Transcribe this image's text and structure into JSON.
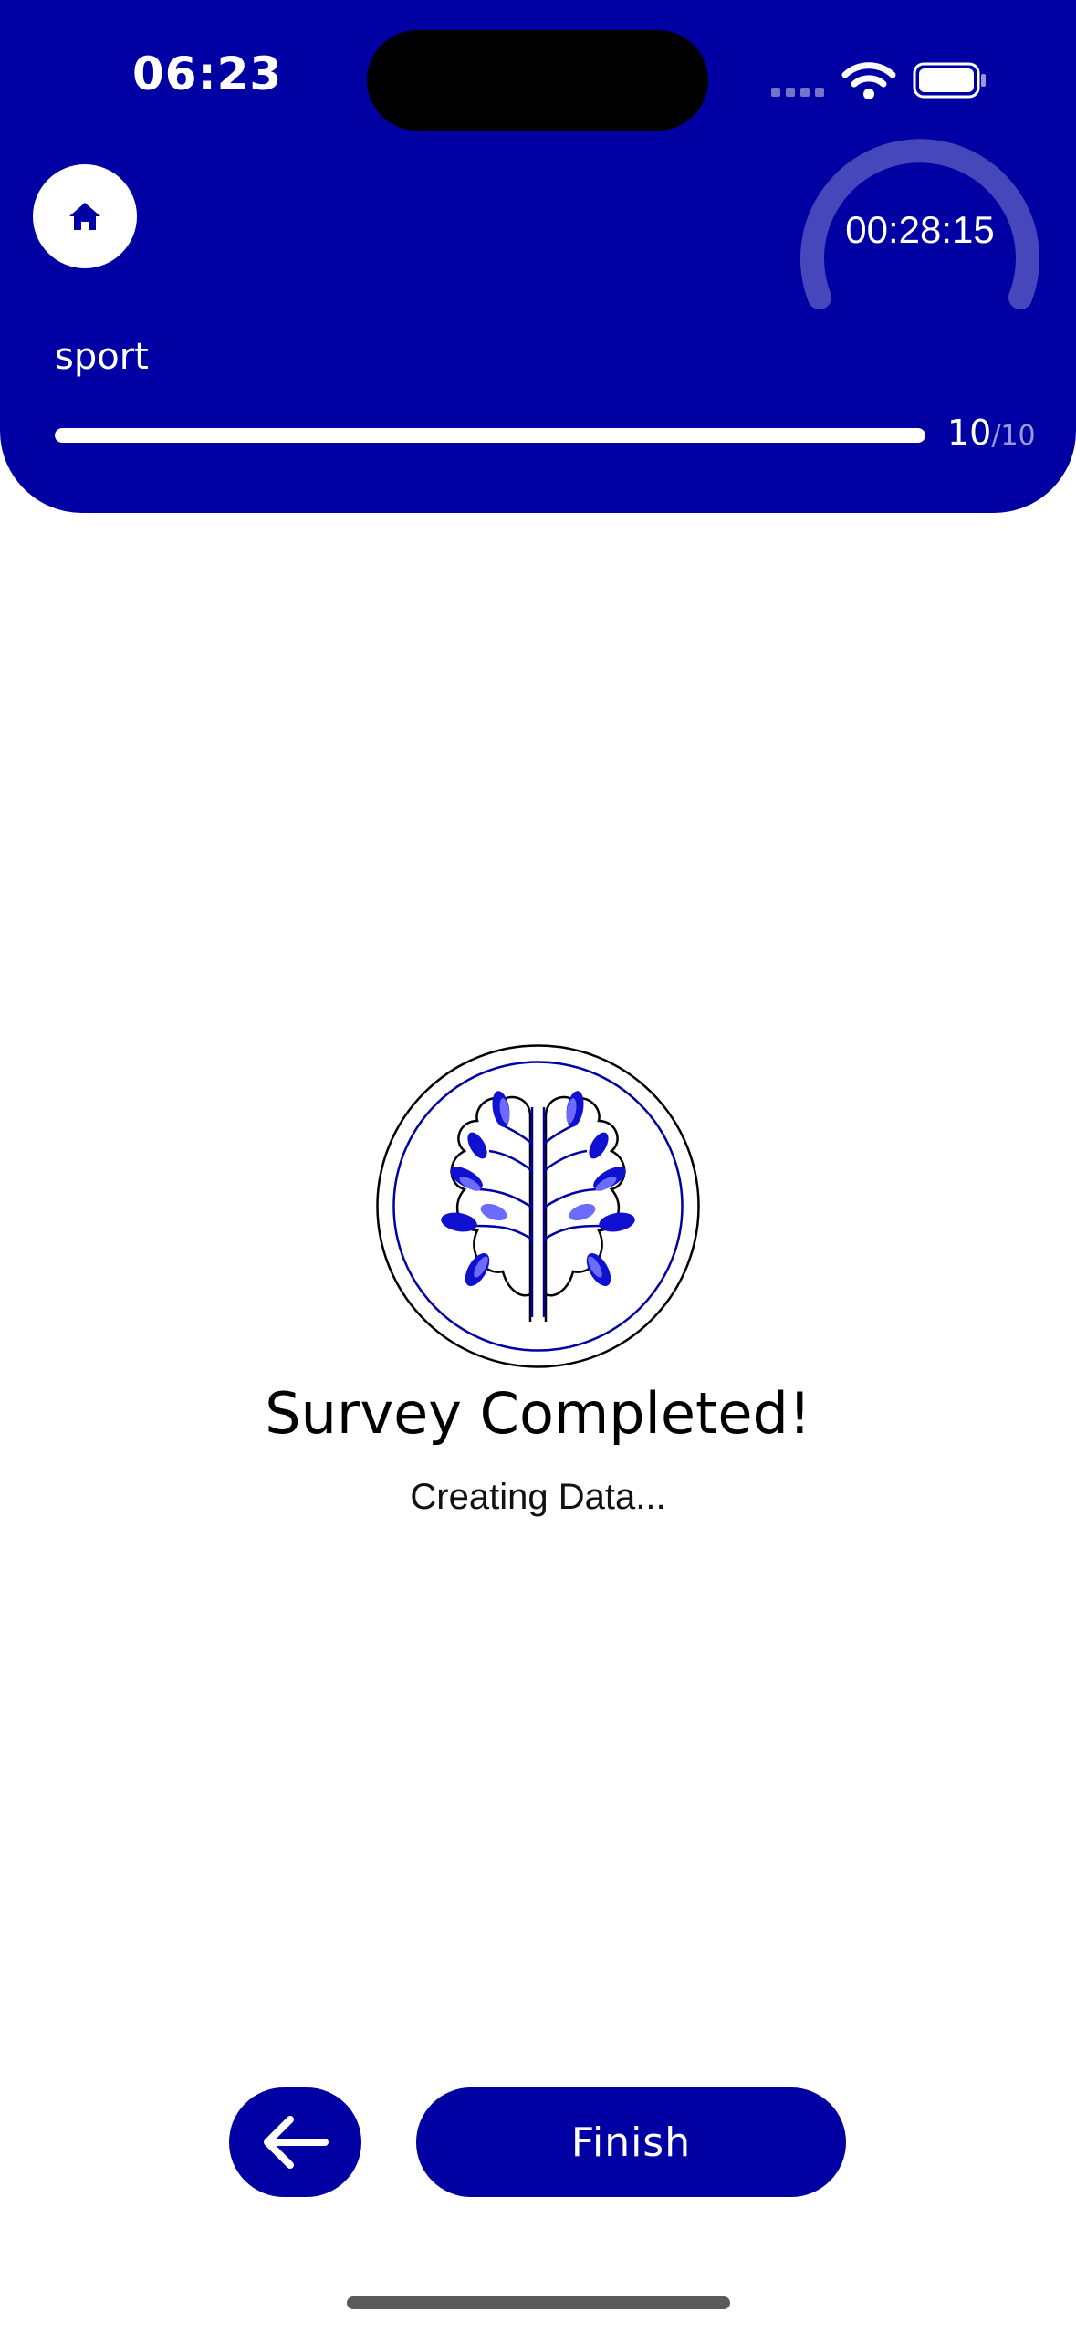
{
  "status_bar": {
    "time": "06:23",
    "icons": [
      "signal-icon",
      "wifi-icon",
      "battery-icon"
    ]
  },
  "header": {
    "home_icon": "home-icon",
    "timer": "00:28:15",
    "category": "sport",
    "progress": {
      "current": "10",
      "separator": "/",
      "total": "10",
      "fraction": 1.0
    }
  },
  "main": {
    "logo_icon": "brain-tree-logo",
    "title": "Survey Completed!",
    "subtitle": "Creating Data..."
  },
  "footer": {
    "back_icon": "arrow-left-icon",
    "finish_label": "Finish"
  },
  "colors": {
    "primary": "#0000A3",
    "leaf_dark": "#1010D0",
    "leaf_light": "#6B6BFF",
    "background": "#FFFFFF"
  }
}
